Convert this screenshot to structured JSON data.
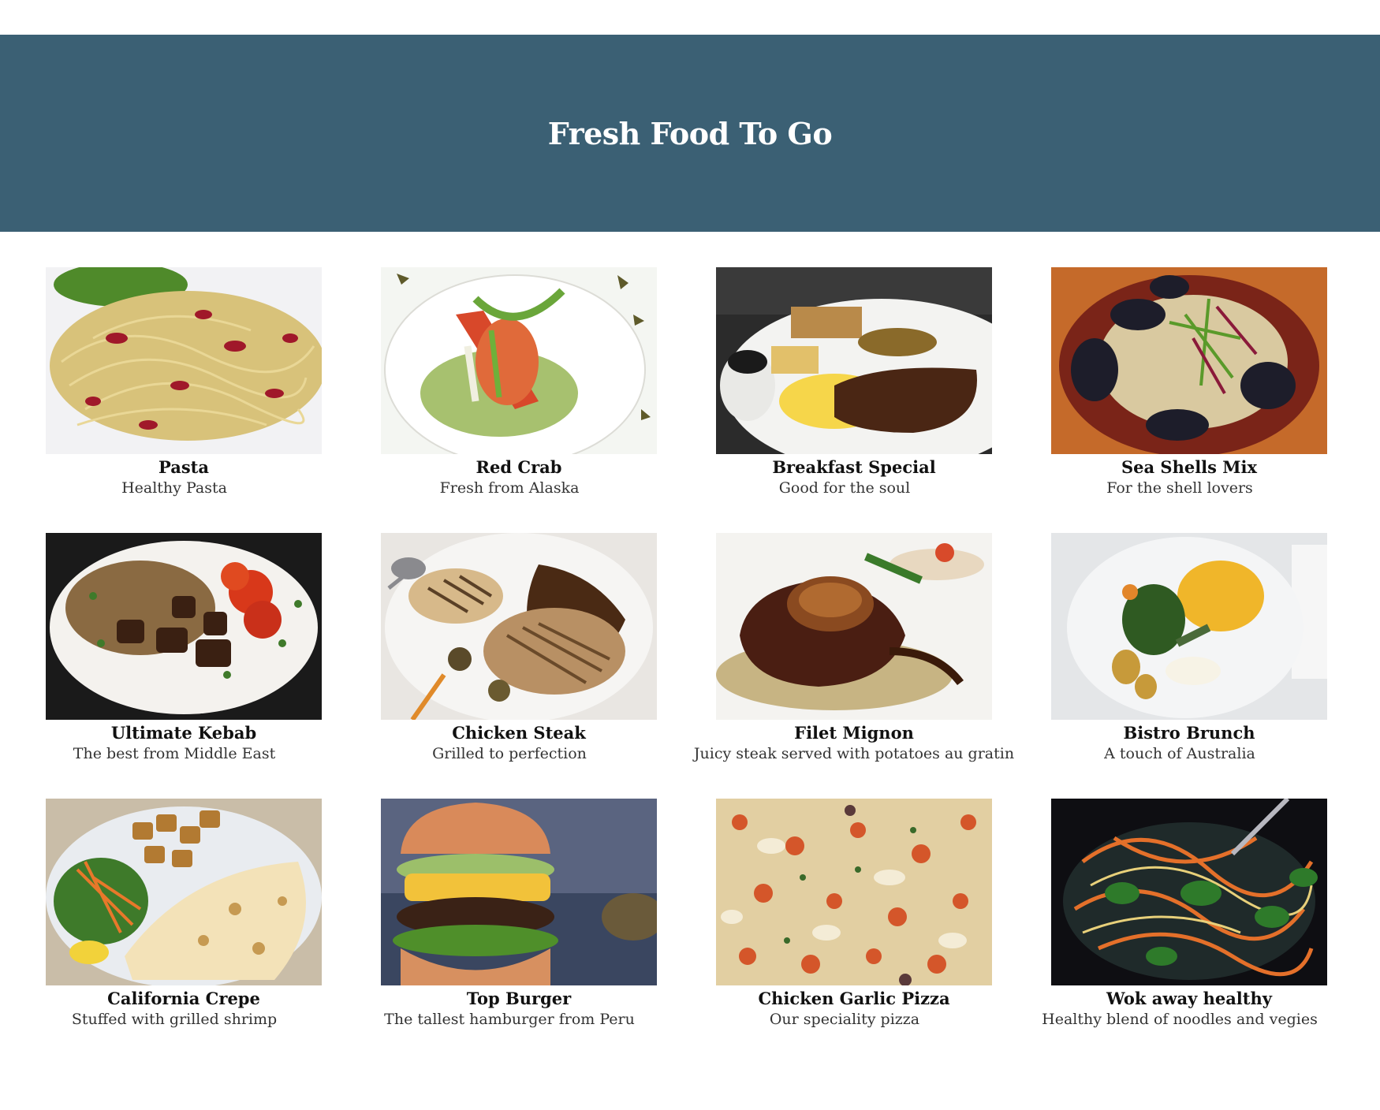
{
  "header": {
    "title": "Fresh Food To Go",
    "background": "#3b6074"
  },
  "menu": [
    {
      "title": "Pasta",
      "subtitle": "Healthy Pasta",
      "image": "pasta-photo"
    },
    {
      "title": "Red Crab",
      "subtitle": "Fresh from Alaska",
      "image": "red-crab-photo"
    },
    {
      "title": "Breakfast Special",
      "subtitle": "Good for the soul",
      "image": "breakfast-photo"
    },
    {
      "title": "Sea Shells Mix",
      "subtitle": "For the shell lovers",
      "image": "mussels-pasta-photo"
    },
    {
      "title": "Ultimate Kebab",
      "subtitle": "The best from Middle East",
      "image": "kebab-photo"
    },
    {
      "title": "Chicken Steak",
      "subtitle": "Grilled to perfection",
      "image": "chicken-steak-photo"
    },
    {
      "title": "Filet Mignon",
      "subtitle": "Juicy steak served with potatoes au gratin",
      "image": "filet-mignon-photo"
    },
    {
      "title": "Bistro Brunch",
      "subtitle": "A touch of Australia",
      "image": "bistro-brunch-photo"
    },
    {
      "title": "California Crepe",
      "subtitle": "Stuffed with grilled shrimp",
      "image": "crepe-photo"
    },
    {
      "title": "Top Burger",
      "subtitle": "The tallest hamburger from Peru",
      "image": "burger-photo"
    },
    {
      "title": "Chicken Garlic Pizza",
      "subtitle": "Our speciality pizza",
      "image": "pizza-photo"
    },
    {
      "title": "Wok away healthy",
      "subtitle": "Healthy blend of noodles and vegies",
      "image": "wok-noodles-photo"
    }
  ]
}
